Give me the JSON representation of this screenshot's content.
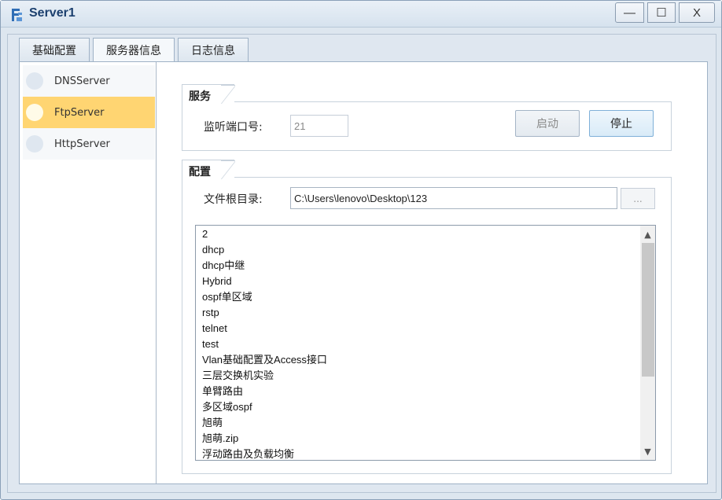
{
  "window": {
    "title": "Server1"
  },
  "titlebar_buttons": {
    "minimize": "—",
    "maximize": "☐",
    "close": "X"
  },
  "tabs": [
    {
      "label": "基础配置"
    },
    {
      "label": "服务器信息"
    },
    {
      "label": "日志信息"
    }
  ],
  "servers": [
    {
      "label": "DNSServer"
    },
    {
      "label": "FtpServer"
    },
    {
      "label": "HttpServer"
    }
  ],
  "service": {
    "group_label": "服务",
    "port_label": "监听端口号:",
    "port_value": "21",
    "start_label": "启动",
    "stop_label": "停止"
  },
  "config": {
    "group_label": "配置",
    "root_label": "文件根目录:",
    "root_value": "C:\\Users\\lenovo\\Desktop\\123",
    "browse_label": "...",
    "files": [
      "2",
      "dhcp",
      "dhcp中继",
      "Hybrid",
      "ospf单区域",
      "rstp",
      "telnet",
      "test",
      "Vlan基础配置及Access接口",
      "三层交换机实验",
      "单臂路由",
      "多区域ospf",
      "旭萌",
      "旭萌.zip",
      "浮动路由及负载均衡"
    ]
  }
}
